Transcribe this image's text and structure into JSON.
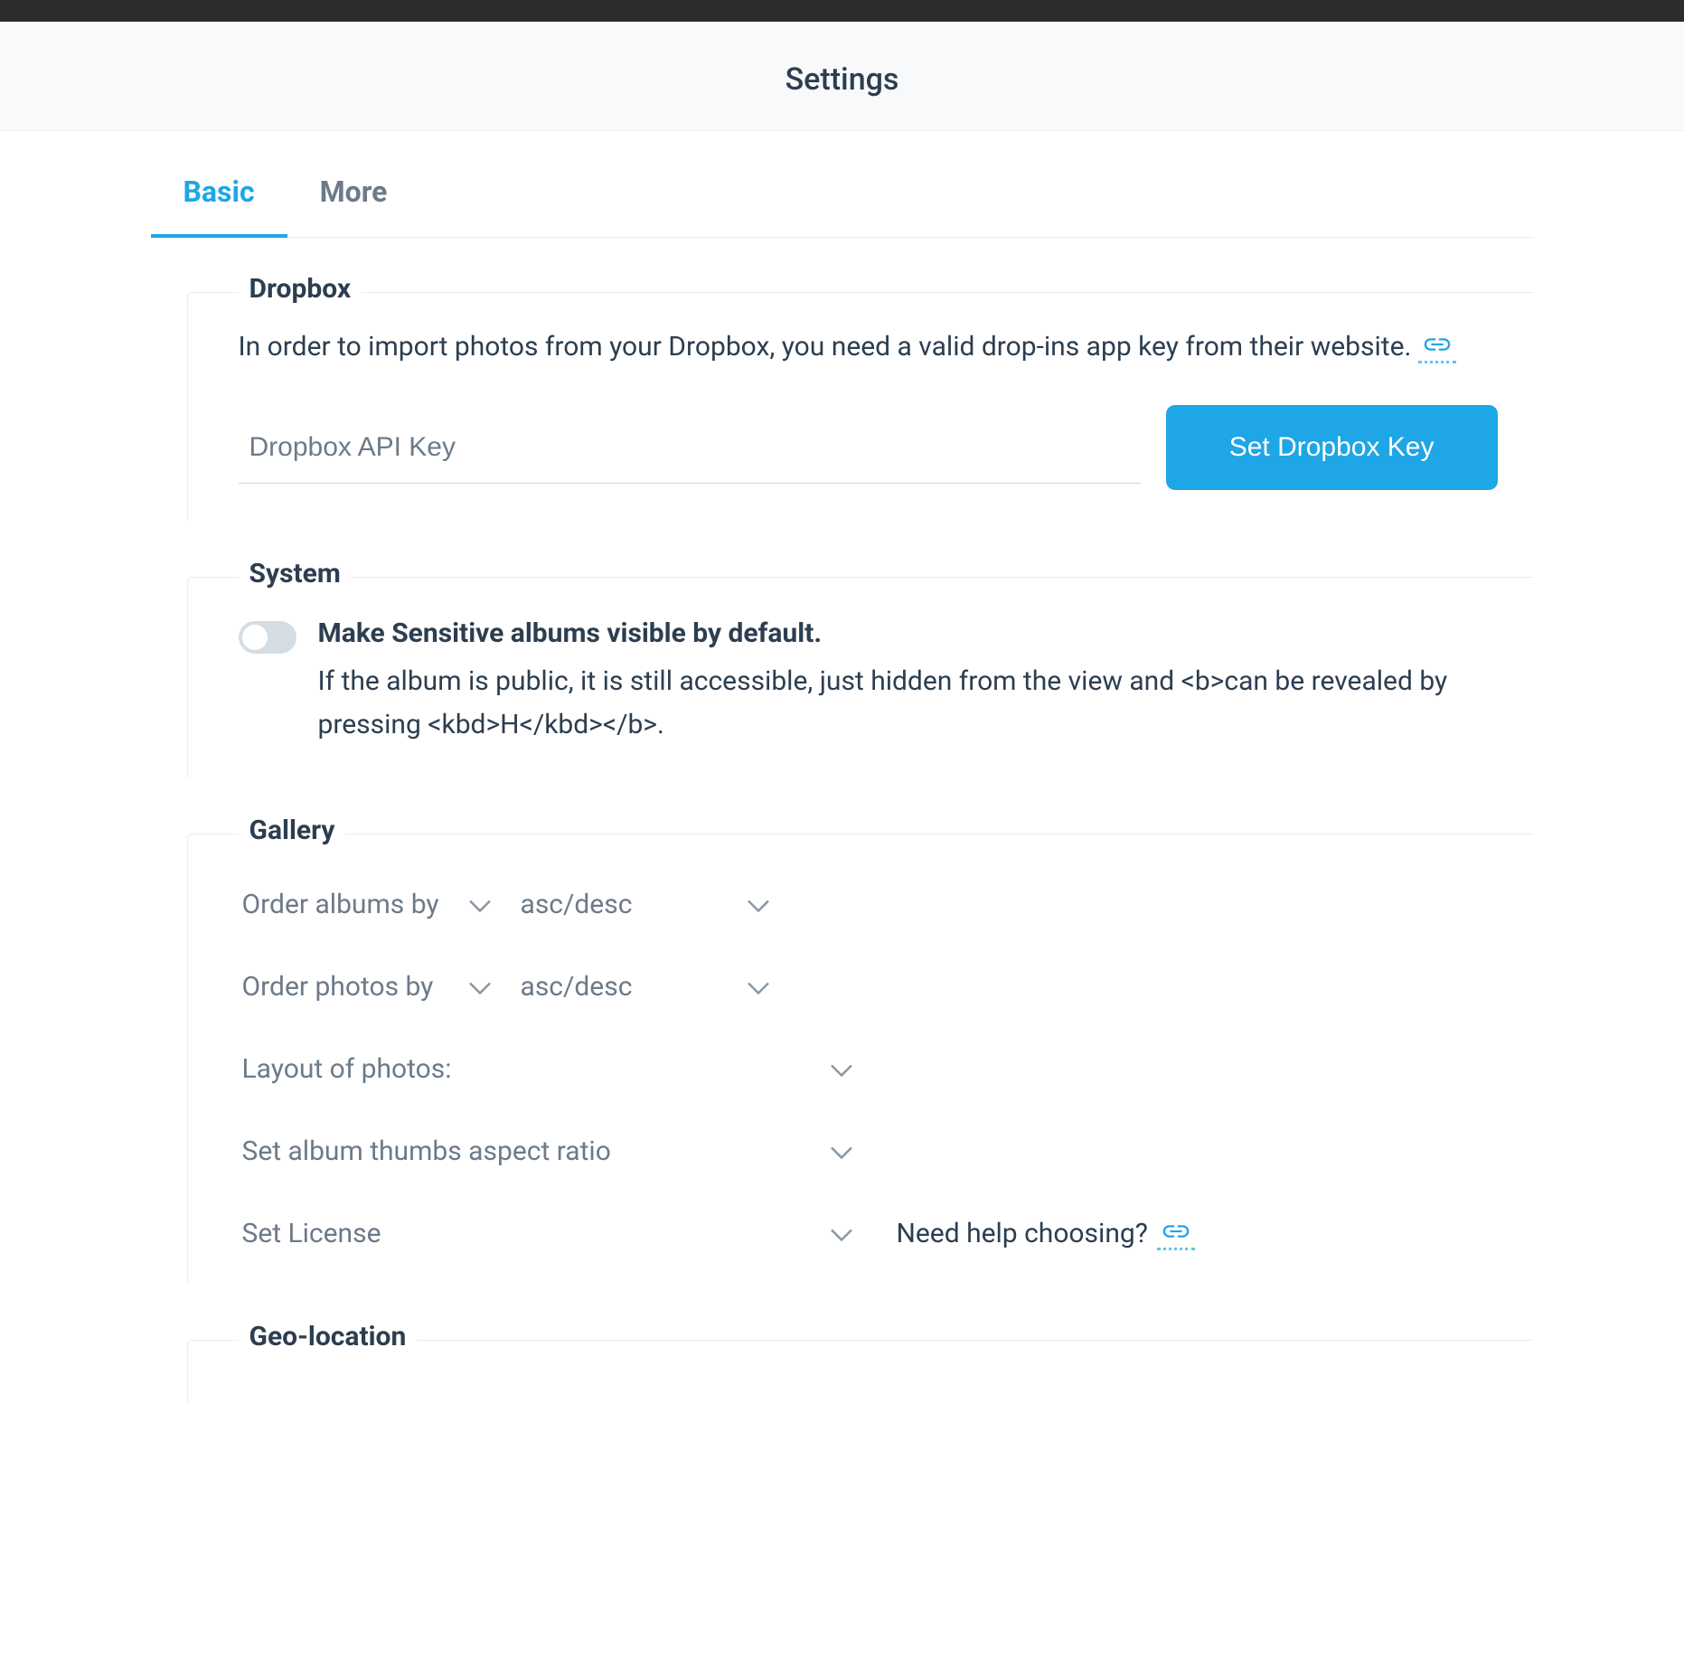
{
  "header": {
    "title": "Settings"
  },
  "tabs": {
    "basic": "Basic",
    "more": "More",
    "active": "basic"
  },
  "sections": {
    "dropbox": {
      "legend": "Dropbox",
      "desc": "In order to import photos from your Dropbox, you need a valid drop-ins app key from their website.",
      "input_placeholder": "Dropbox API Key",
      "input_value": "",
      "button": "Set Dropbox Key"
    },
    "system": {
      "legend": "System",
      "sensitive": {
        "title": "Make Sensitive albums visible by default.",
        "desc": "If the album is public, it is still accessible, just hidden from the view and <b>can be revealed by pressing <kbd>H</kbd></b>.",
        "enabled": false
      }
    },
    "gallery": {
      "legend": "Gallery",
      "order_albums": {
        "label": "Order albums by",
        "direction": "asc/desc"
      },
      "order_photos": {
        "label": "Order photos by",
        "direction": "asc/desc"
      },
      "layout": {
        "label": "Layout of photos:"
      },
      "aspect": {
        "label": "Set album thumbs aspect ratio"
      },
      "license": {
        "label": "Set License",
        "help": "Need help choosing?"
      }
    },
    "geolocation": {
      "legend": "Geo-location"
    }
  }
}
